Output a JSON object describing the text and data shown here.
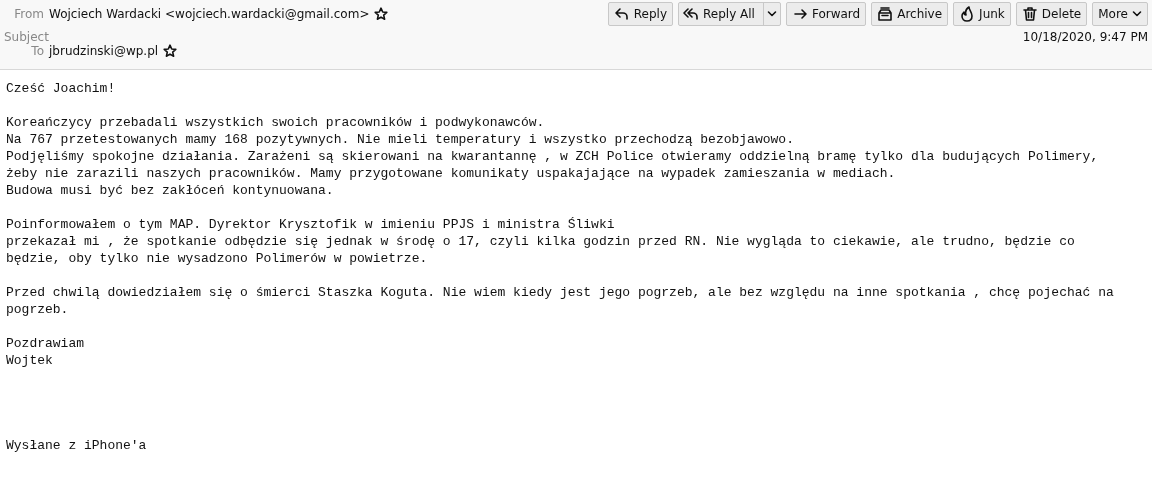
{
  "header": {
    "from_label": "From",
    "from": "Wojciech Wardacki <wojciech.wardacki@gmail.com>",
    "subject_label": "Subject",
    "to_label": "To",
    "to": "jbrudzinski@wp.pl",
    "date": "10/18/2020, 9:47 PM"
  },
  "buttons": [
    {
      "kind": "reply",
      "label": "Reply"
    },
    {
      "kind": "reply-all",
      "label": "Reply All"
    },
    {
      "kind": "forward",
      "label": "Forward"
    },
    {
      "kind": "archive",
      "label": "Archive"
    },
    {
      "kind": "junk",
      "label": "Junk"
    },
    {
      "kind": "delete",
      "label": "Delete"
    },
    {
      "kind": "more",
      "label": "More"
    }
  ],
  "body": {
    "paragraphs": [
      [
        "Cześć Joachim!"
      ],
      [
        "Koreańczycy przebadali wszystkich swoich pracowników i podwykonawców.",
        "Na 767 przetestowanych mamy 168 pozytywnych. Nie mieli temperatury i wszystko przechodzą bezobjawowo.",
        "Podjęliśmy spokojne działania. Zarażeni są skierowani na kwarantannę , w ZCH Police otwieramy oddzielną bramę tylko dla budujących Polimery,",
        "żeby nie zarazili naszych pracowników. Mamy przygotowane komunikaty uspakajające na wypadek zamieszania w mediach.",
        "Budowa musi być bez zakłóceń kontynuowana."
      ],
      [
        "Poinformowałem o tym MAP. Dyrektor Krysztofik w imieniu PPJS i ministra Śliwki",
        "przekazał mi , że spotkanie odbędzie się jednak w środę o 17, czyli kilka godzin przed RN. Nie wygląda to ciekawie, ale trudno, będzie co",
        "będzie, oby tylko nie wysadzono Polimerów w powietrze."
      ],
      [
        "Przed chwilą dowiedziałem się o śmierci Staszka Koguta. Nie wiem kiedy jest jego pogrzeb, ale bez względu na inne spotkania , chcę pojechać na",
        "pogrzeb."
      ],
      [
        "Pozdrawiam",
        "Wojtek"
      ]
    ],
    "signature": "Wysłane z iPhone'a"
  }
}
